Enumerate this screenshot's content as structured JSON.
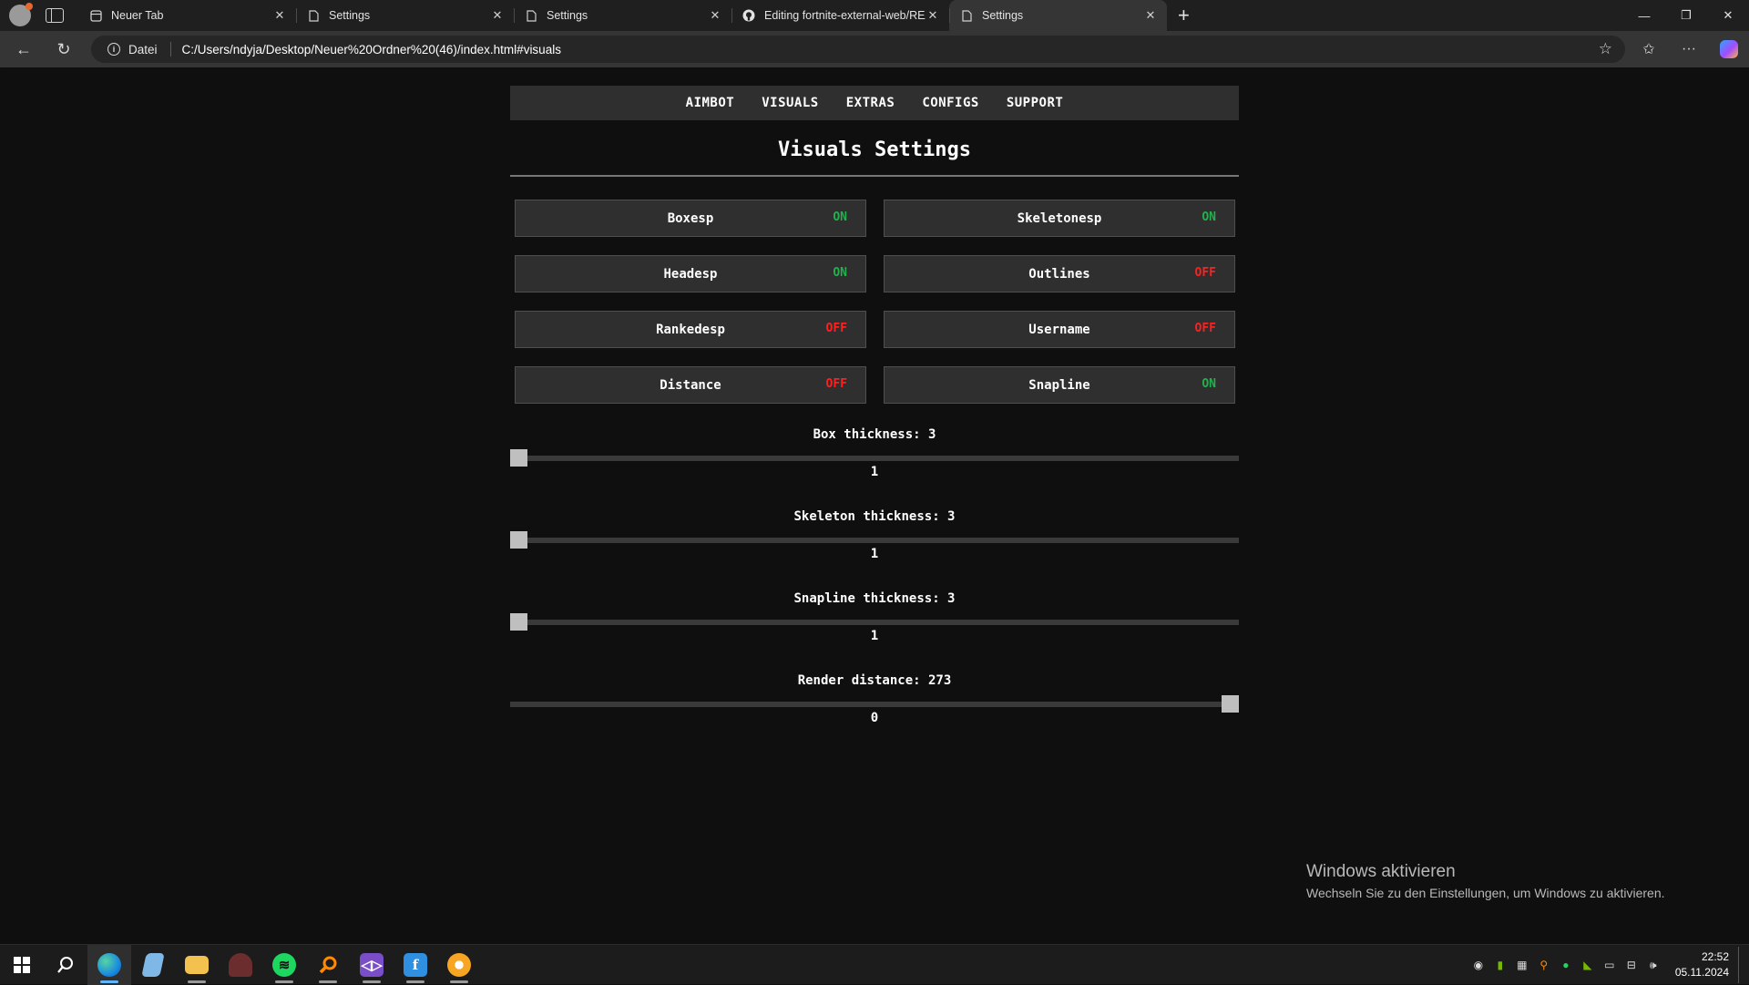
{
  "browser": {
    "tabs": [
      {
        "title": "Neuer Tab",
        "icon": "new-tab-page-icon",
        "active": false
      },
      {
        "title": "Settings",
        "icon": "page-icon",
        "active": false
      },
      {
        "title": "Settings",
        "icon": "page-icon",
        "active": false
      },
      {
        "title": "Editing fortnite-external-web/REA",
        "icon": "github-icon",
        "active": false
      },
      {
        "title": "Settings",
        "icon": "page-icon",
        "active": true
      }
    ],
    "address": {
      "scheme_label": "Datei",
      "url": "C:/Users/ndyja/Desktop/Neuer%20Ordner%20(46)/index.html#visuals"
    }
  },
  "page": {
    "menu": [
      "AIMBOT",
      "VISUALS",
      "EXTRAS",
      "CONFIGS",
      "SUPPORT"
    ],
    "heading": "Visuals Settings",
    "toggles": [
      {
        "label": "Boxesp",
        "state": "ON"
      },
      {
        "label": "Skeletonesp",
        "state": "ON"
      },
      {
        "label": "Headesp",
        "state": "ON"
      },
      {
        "label": "Outlines",
        "state": "OFF"
      },
      {
        "label": "Rankedesp",
        "state": "OFF"
      },
      {
        "label": "Username",
        "state": "OFF"
      },
      {
        "label": "Distance",
        "state": "OFF"
      },
      {
        "label": "Snapline",
        "state": "ON"
      }
    ],
    "sliders": [
      {
        "title": "Box thickness: 3",
        "value": "1",
        "position": 0.0
      },
      {
        "title": "Skeleton thickness: 3",
        "value": "1",
        "position": 0.0
      },
      {
        "title": "Snapline thickness: 3",
        "value": "1",
        "position": 0.0
      },
      {
        "title": "Render distance: 273",
        "value": "0",
        "position": 1.0
      }
    ]
  },
  "watermark": {
    "title": "Windows aktivieren",
    "subtitle": "Wechseln Sie zu den Einstellungen, um Windows zu aktivieren."
  },
  "taskbar": {
    "apps": [
      "windows-start-icon",
      "search-icon",
      "edge-icon",
      "notepad-icon",
      "file-explorer-icon",
      "character-app-icon",
      "spotify-icon",
      "search-tool-icon",
      "visual-studio-icon",
      "app-f-icon",
      "chrome-canary-icon"
    ],
    "clock_time": "22:52",
    "clock_date": "05.11.2024"
  },
  "colors": {
    "on": "#22b14c",
    "off": "#ff2020",
    "panel": "#2f2f2f",
    "background": "#0f0f0f"
  }
}
